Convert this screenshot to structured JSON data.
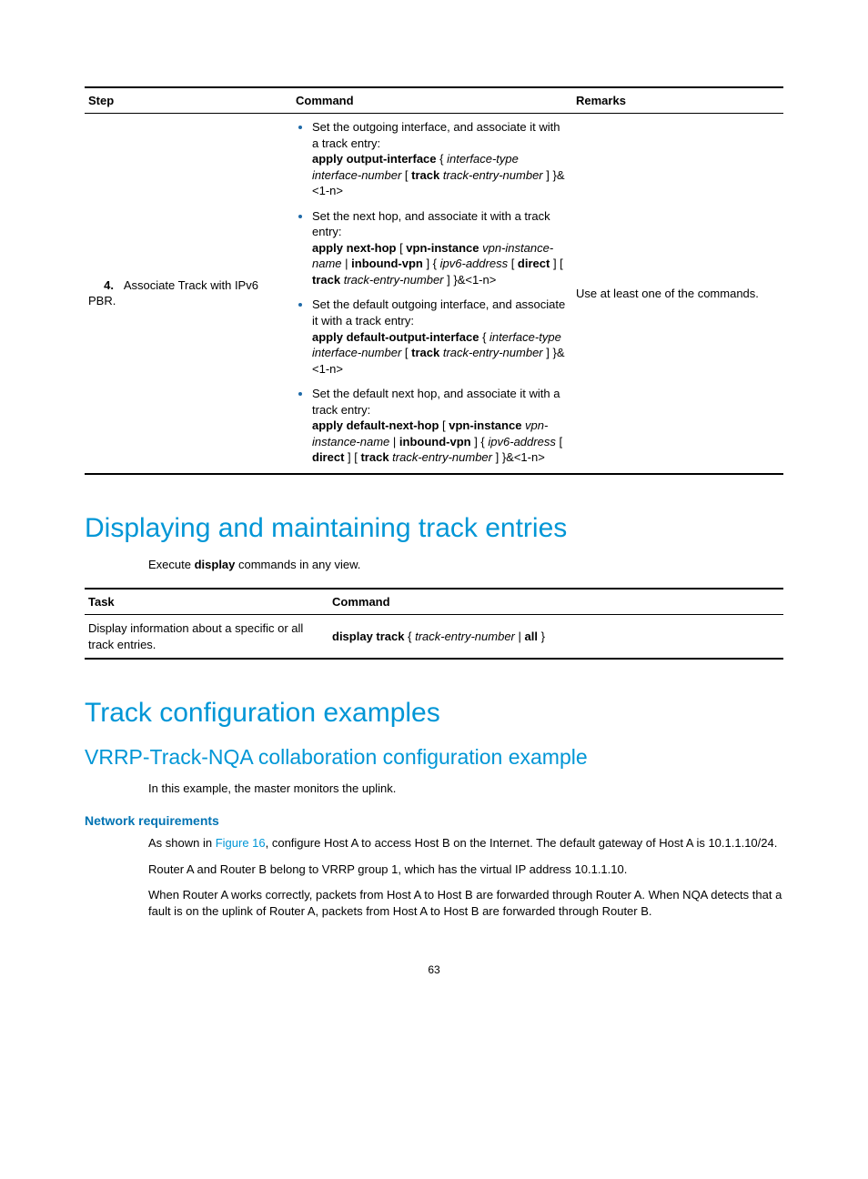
{
  "table1": {
    "headers": {
      "step": "Step",
      "command": "Command",
      "remarks": "Remarks"
    },
    "row": {
      "num": "4.",
      "step": "Associate Track with IPv6 PBR.",
      "remarks": "Use at least one of the commands.",
      "items": [
        {
          "desc": "Set the outgoing interface, and associate it with a track entry:",
          "syntax_parts": {
            "p1": "apply output-interface",
            "p2": " { ",
            "p3": "interface-type interface-number",
            "p4": " [ ",
            "p5": "track",
            "p6": " ",
            "p7": "track-entry-number",
            "p8": " ] }&<1-n>"
          }
        },
        {
          "desc": "Set the next hop, and associate it with a track entry:",
          "syntax_parts": {
            "p1": "apply next-hop",
            "p2": " [ ",
            "p3": "vpn-instance",
            "p4": " ",
            "p5": "vpn-instance-name",
            "p6": " | ",
            "p7": "inbound-vpn",
            "p8": " ] { ",
            "p9": "ipv6-address",
            "p10": " [ ",
            "p11": "direct",
            "p12": " ] [ ",
            "p13": "track",
            "p14": " ",
            "p15": "track-entry-number",
            "p16": " ] }&<1-n>"
          }
        },
        {
          "desc": "Set the default outgoing interface, and associate it with a track entry:",
          "syntax_parts": {
            "p1": "apply default-output-interface",
            "p2": " { ",
            "p3": "interface-type interface-number",
            "p4": " [ ",
            "p5": "track",
            "p6": " ",
            "p7": "track-entry-number",
            "p8": " ] }&<1-n>"
          }
        },
        {
          "desc": "Set the default next hop, and associate it with a track entry:",
          "syntax_parts": {
            "p1": "apply default-next-hop",
            "p2": " [ ",
            "p3": "vpn-instance",
            "p4": " ",
            "p5": "vpn-instance-name",
            "p6": " | ",
            "p7": "inbound-vpn",
            "p8": " ] { ",
            "p9": "ipv6-address",
            "p10": " [ ",
            "p11": "direct",
            "p12": " ] [ ",
            "p13": "track",
            "p14": " ",
            "p15": "track-entry-number",
            "p16": " ] }&<1-n>"
          }
        }
      ]
    }
  },
  "h1a": "Displaying and maintaining track entries",
  "execline": {
    "p1": "Execute ",
    "p2": "display",
    "p3": " commands in any view."
  },
  "table2": {
    "headers": {
      "task": "Task",
      "command": "Command"
    },
    "row": {
      "task": "Display information about a specific or all track entries.",
      "cmd": {
        "p1": "display track",
        "p2": " { ",
        "p3": "track-entry-number",
        "p4": " | ",
        "p5": "all",
        "p6": " }"
      }
    }
  },
  "h1b": "Track configuration examples",
  "h2a": "VRRP-Track-NQA collaboration configuration example",
  "p_intro2": "In this example, the master monitors the uplink.",
  "h3a": "Network requirements",
  "para1": {
    "p1": "As shown in ",
    "link": "Figure 16",
    "p2": ", configure Host A to access Host B on the Internet. The default gateway of Host A is 10.1.1.10/24."
  },
  "para2": "Router A and Router B belong to VRRP group 1, which has the virtual IP address 10.1.1.10.",
  "para3": "When Router A works correctly, packets from Host A to Host B are forwarded through Router A. When NQA detects that a fault is on the uplink of Router A, packets from Host A to Host B are forwarded through Router B.",
  "pagenum": "63"
}
